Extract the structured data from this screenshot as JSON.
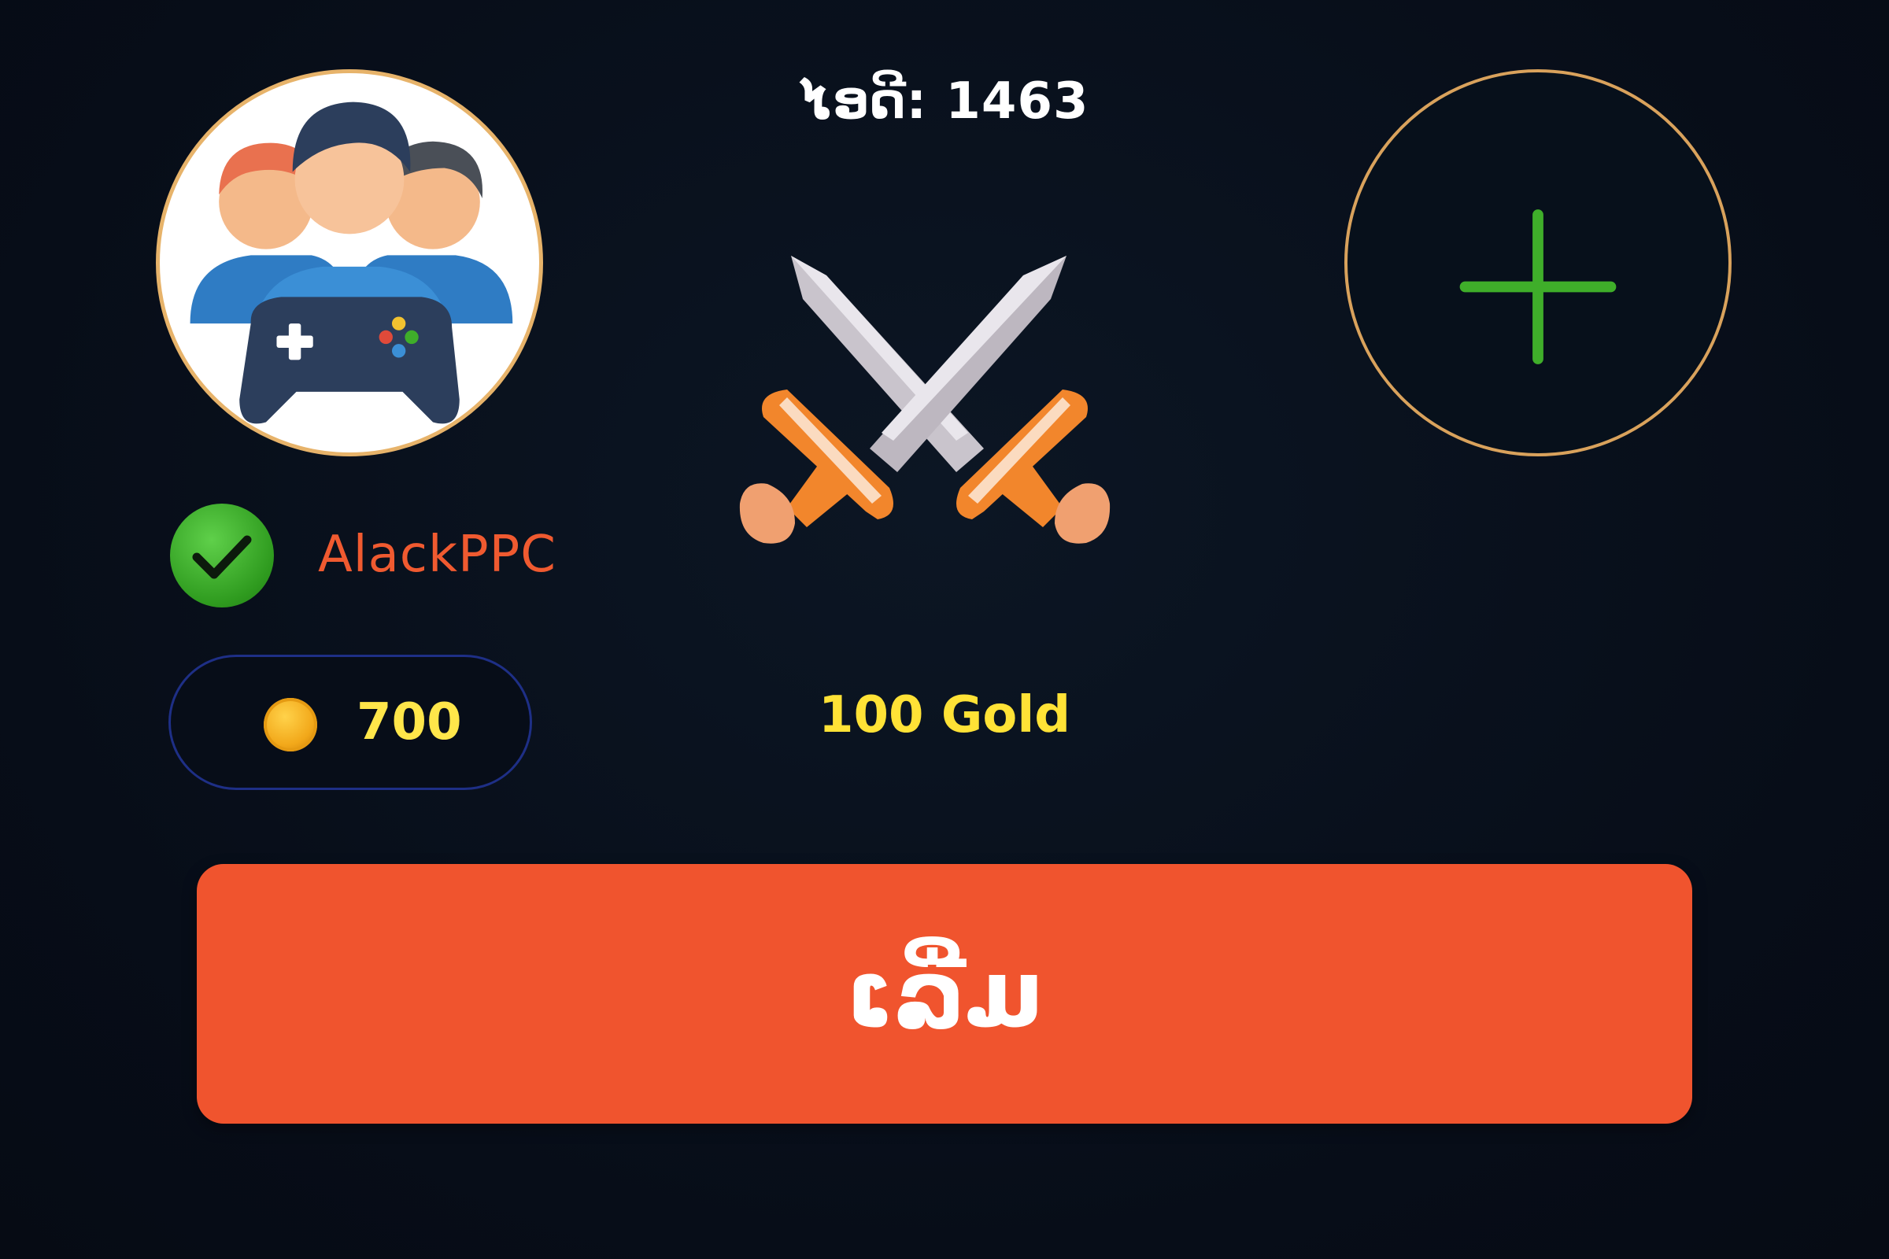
{
  "player": {
    "id_label": "ໄອດີ: 1463",
    "username": "AlackPPC",
    "coins": "700",
    "verified": true,
    "avatar_icon": "gamers-group-icon"
  },
  "match": {
    "prize": "100 Gold",
    "versus_icon": "crossed-swords-icon",
    "opponent_slot_icon": "plus-icon"
  },
  "start_button": {
    "label": "ເລີ່ມ"
  },
  "colors": {
    "background": "#08101c",
    "accent": "#f0542e",
    "gold_text": "#ffe236",
    "username": "#f05a30",
    "verified": "#2e9a1e",
    "ring": "#d9a25c",
    "plus": "#3fae2a"
  }
}
